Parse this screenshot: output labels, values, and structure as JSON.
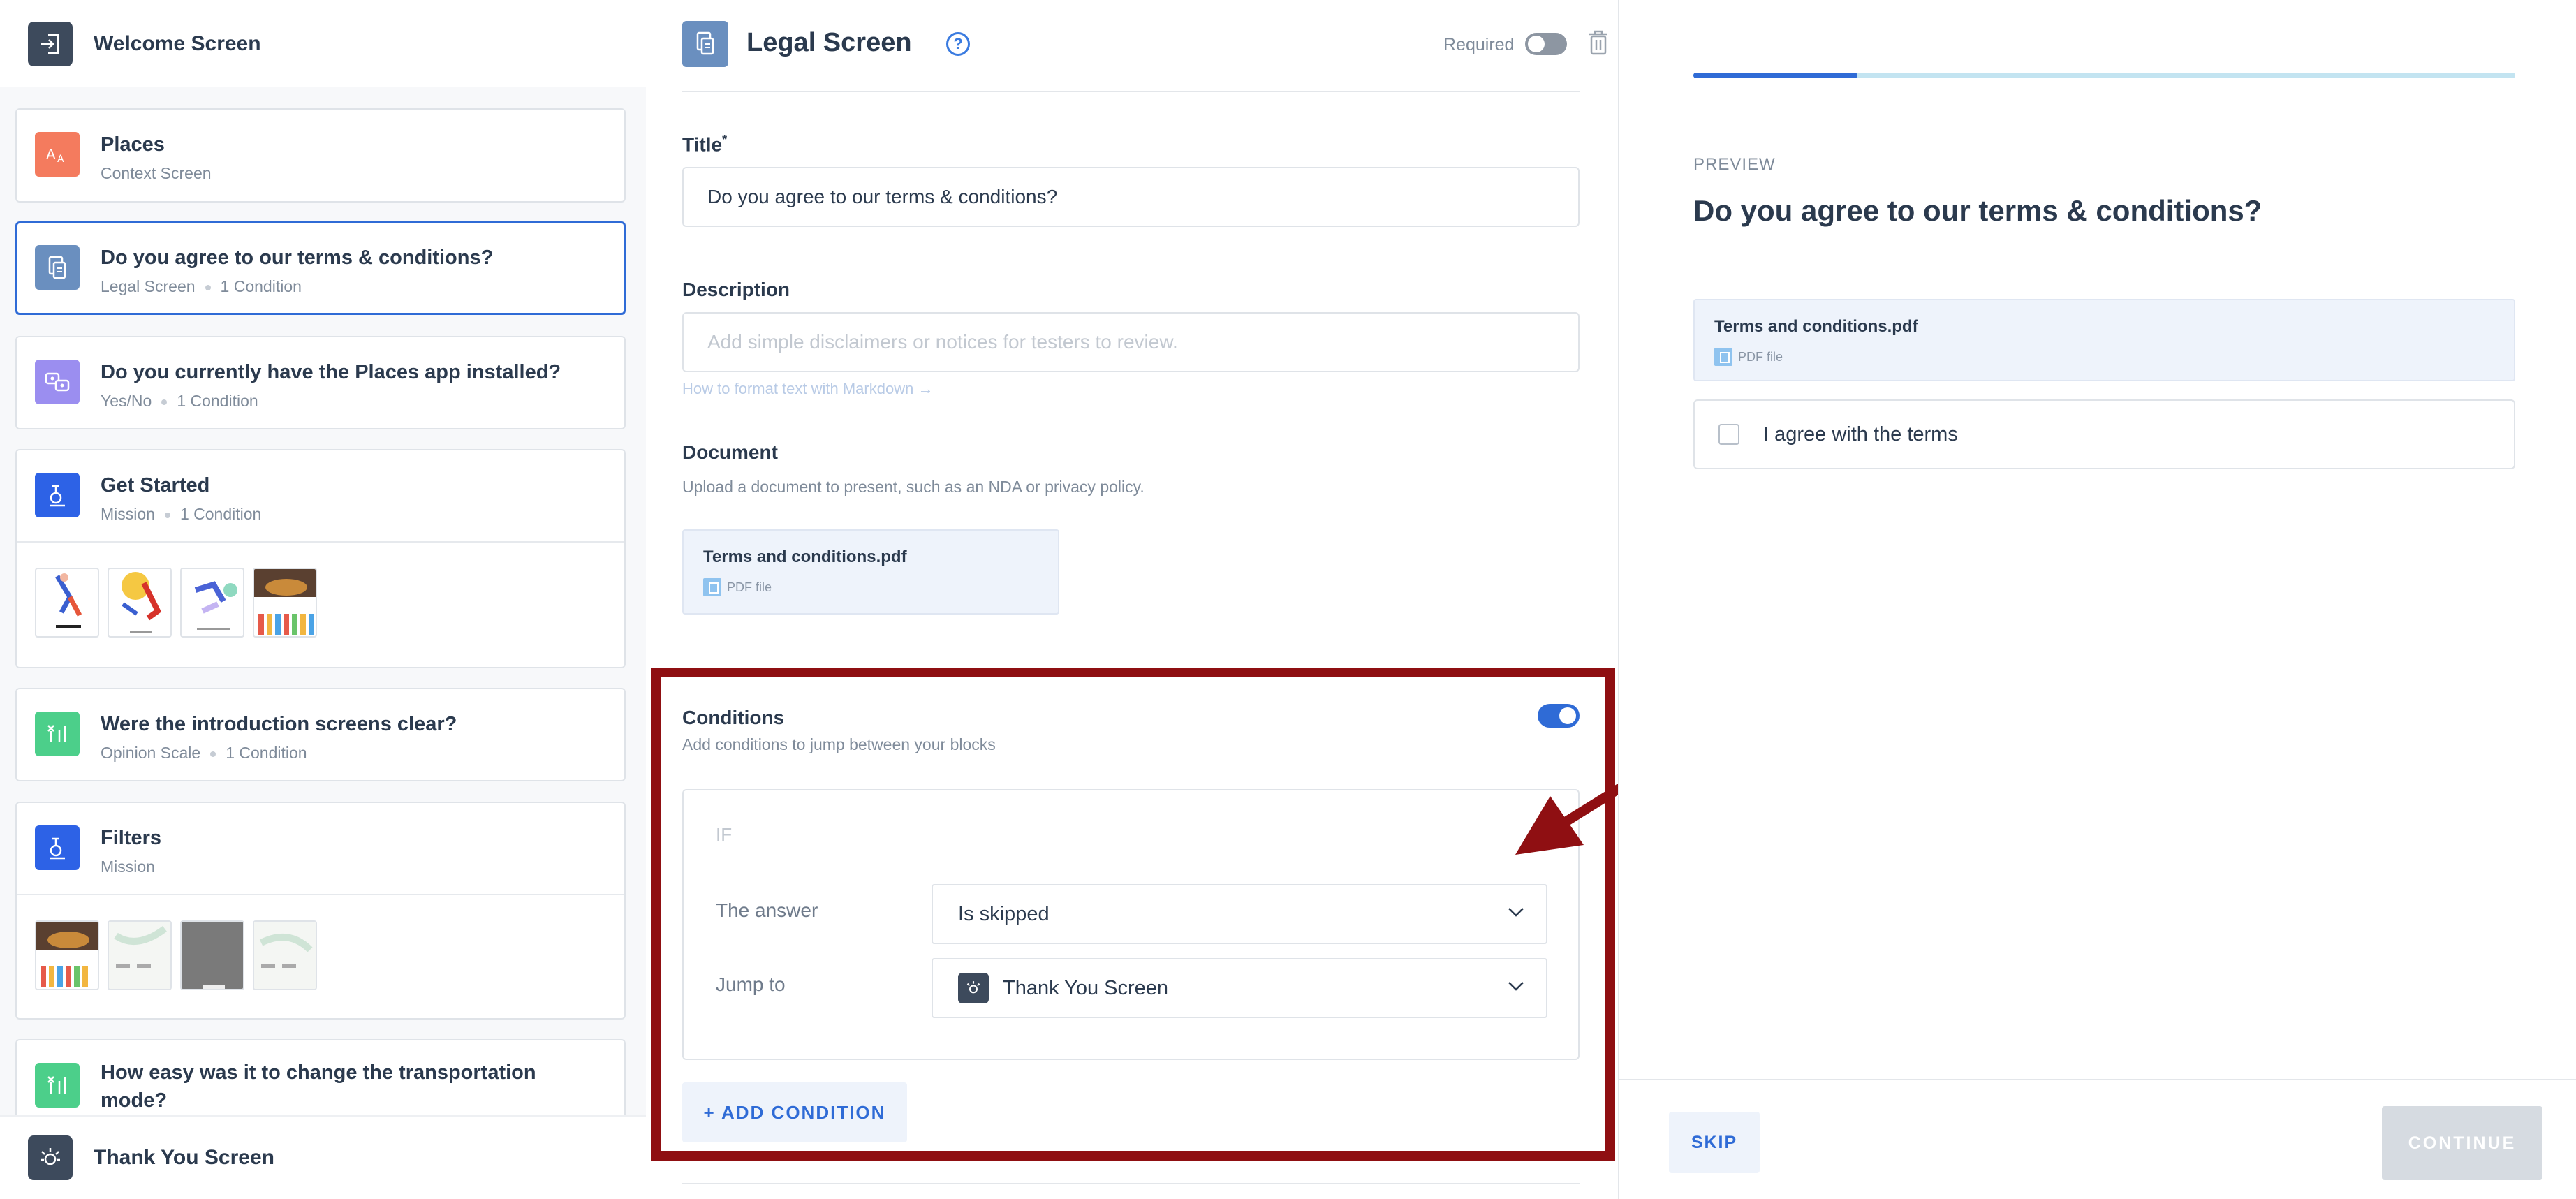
{
  "sidebar": {
    "welcome": {
      "label": "Welcome Screen"
    },
    "cards": [
      {
        "title": "Places",
        "subtitle": "Context Screen",
        "condition": ""
      },
      {
        "title": "Do you agree to our terms & conditions?",
        "subtitle": "Legal Screen",
        "condition": "1 Condition"
      },
      {
        "title": "Do you currently have the Places app installed?",
        "subtitle": "Yes/No",
        "condition": "1 Condition"
      },
      {
        "title": "Get Started",
        "subtitle": "Mission",
        "condition": "1 Condition"
      },
      {
        "title": "Were the introduction screens clear?",
        "subtitle": "Opinion Scale",
        "condition": "1 Condition"
      },
      {
        "title": "Filters",
        "subtitle": "Mission",
        "condition": ""
      },
      {
        "title": "How easy was it to change the transportation mode?",
        "subtitle": "",
        "condition": ""
      }
    ],
    "thankyou": {
      "label": "Thank You Screen"
    }
  },
  "editor": {
    "title": "Legal Screen",
    "required_label": "Required",
    "title_field": {
      "label": "Title",
      "required_mark": "*",
      "value": "Do you agree to our terms & conditions?"
    },
    "description_field": {
      "label": "Description",
      "placeholder": "Add simple disclaimers or notices for testers to review.",
      "markdown_link": "How to format text with Markdown →"
    },
    "document": {
      "label": "Document",
      "help": "Upload a document to present, such as an NDA or privacy policy.",
      "file_name": "Terms and conditions.pdf",
      "file_type": "PDF file"
    },
    "conditions": {
      "title": "Conditions",
      "help": "Add conditions to jump between your blocks",
      "enabled": true,
      "if_label": "IF",
      "answer_label": "The answer",
      "answer_value": "Is skipped",
      "jump_label": "Jump to",
      "jump_value": "Thank You Screen",
      "add_button": "+ ADD CONDITION"
    }
  },
  "preview": {
    "progress": 0.2,
    "label": "PREVIEW",
    "question": "Do you agree to our terms & conditions?",
    "file_name": "Terms and conditions.pdf",
    "file_type": "PDF file",
    "checkbox_label": "I agree with the terms",
    "skip": "SKIP",
    "continue": "CONTINUE"
  },
  "colors": {
    "accent": "#2f6bd6",
    "annotation": "#8f0f12",
    "context_icon": "#f47b5e",
    "legal_icon": "#6a8fbf",
    "yesno_icon": "#9b8ef0",
    "mission_icon": "#2d62e6",
    "opinion_icon": "#4ccf8a"
  }
}
